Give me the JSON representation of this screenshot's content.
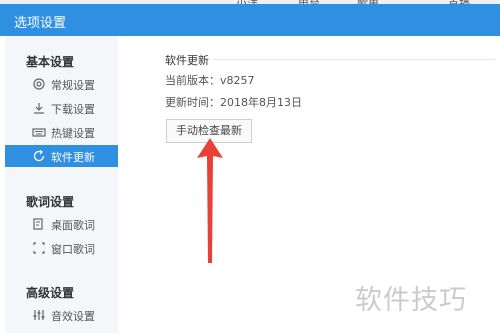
{
  "background_tabs": [
    "小洋",
    "电台",
    "歌单",
    "首播"
  ],
  "window": {
    "title": "选项设置"
  },
  "sidebar": {
    "sections": [
      {
        "title": "基本设置",
        "items": [
          {
            "label": "常规设置",
            "icon": "gear-icon"
          },
          {
            "label": "下载设置",
            "icon": "download-icon"
          },
          {
            "label": "热键设置",
            "icon": "keyboard-icon"
          },
          {
            "label": "软件更新",
            "icon": "update-icon",
            "active": true
          }
        ]
      },
      {
        "title": "歌词设置",
        "items": [
          {
            "label": "桌面歌词",
            "icon": "desktop-lyrics-icon"
          },
          {
            "label": "窗口歌词",
            "icon": "window-lyrics-icon"
          }
        ]
      },
      {
        "title": "高级设置",
        "items": [
          {
            "label": "音效设置",
            "icon": "equalizer-icon"
          }
        ]
      }
    ]
  },
  "main": {
    "section_title": "软件更新",
    "current_version": "当前版本：v8257",
    "update_time": "更新时间：2018年8月13日",
    "check_button": "手动检查最新"
  },
  "annotation": {
    "arrow_color": "#e8413a"
  },
  "watermark": "软件技巧",
  "colors": {
    "accent": "#2f8fe0"
  }
}
